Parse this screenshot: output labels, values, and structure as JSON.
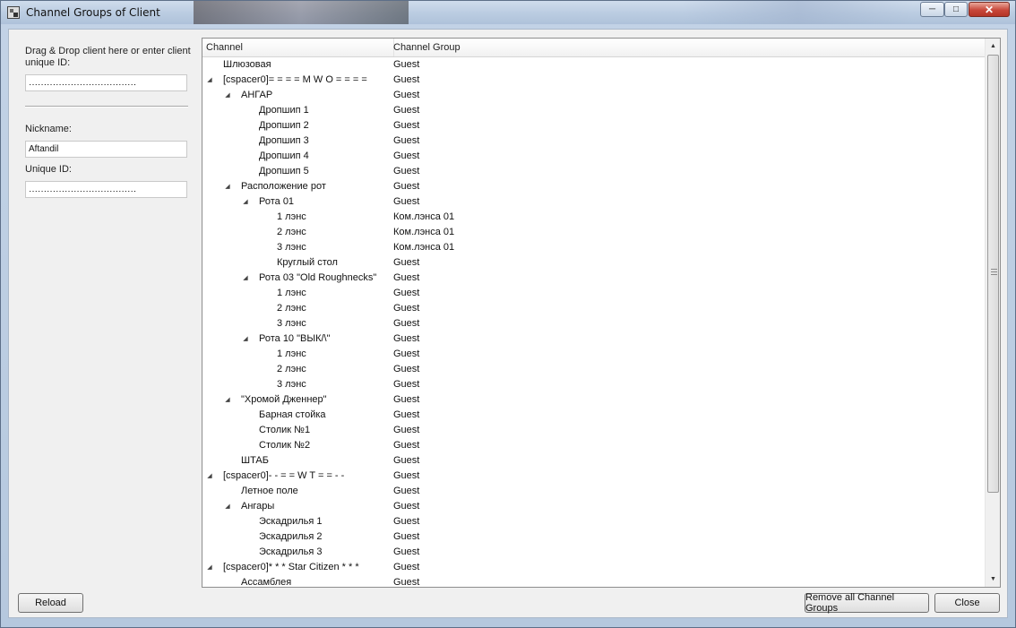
{
  "window": {
    "title": "Channel Groups of Client"
  },
  "left": {
    "drag_label": "Drag & Drop client here or enter client unique ID:",
    "client_id_value": "‥‥‥‥‥‥‥‥‥‥‥‥‥‥‥‥‥‥",
    "nickname_label": "Nickname:",
    "nickname_value": "Aftandil",
    "unique_id_label": "Unique ID:",
    "unique_id_value": "‥‥‥‥‥‥‥‥‥‥‥‥‥‥‥‥‥‥"
  },
  "tree": {
    "col_channel": "Channel",
    "col_group": "Channel Group",
    "rows": [
      {
        "name": "Шлюзовая",
        "group": "Guest",
        "depth": 1,
        "expandable": false
      },
      {
        "name": "[cspacer0]= = = = M W O = = = =",
        "group": "Guest",
        "depth": 1,
        "expandable": true
      },
      {
        "name": "АНГАР",
        "group": "Guest",
        "depth": 2,
        "expandable": true
      },
      {
        "name": "Дропшип 1",
        "group": "Guest",
        "depth": 3,
        "expandable": false
      },
      {
        "name": "Дропшип 2",
        "group": "Guest",
        "depth": 3,
        "expandable": false
      },
      {
        "name": "Дропшип 3",
        "group": "Guest",
        "depth": 3,
        "expandable": false
      },
      {
        "name": "Дропшип 4",
        "group": "Guest",
        "depth": 3,
        "expandable": false
      },
      {
        "name": "Дропшип 5",
        "group": "Guest",
        "depth": 3,
        "expandable": false
      },
      {
        "name": "Расположение рот",
        "group": "Guest",
        "depth": 2,
        "expandable": true
      },
      {
        "name": "Рота 01",
        "group": "Guest",
        "depth": 3,
        "expandable": true
      },
      {
        "name": "1 лэнс",
        "group": "Ком.лэнса 01",
        "depth": 4,
        "expandable": false
      },
      {
        "name": "2 лэнс",
        "group": "Ком.лэнса 01",
        "depth": 4,
        "expandable": false
      },
      {
        "name": "3 лэнс",
        "group": "Ком.лэнса 01",
        "depth": 4,
        "expandable": false
      },
      {
        "name": "Круглый стол",
        "group": "Guest",
        "depth": 4,
        "expandable": false
      },
      {
        "name": "Рота 03 \"Old Roughnecks\"",
        "group": "Guest",
        "depth": 3,
        "expandable": true
      },
      {
        "name": "1 лэнс",
        "group": "Guest",
        "depth": 4,
        "expandable": false
      },
      {
        "name": "2 лэнс",
        "group": "Guest",
        "depth": 4,
        "expandable": false
      },
      {
        "name": "3 лэнс",
        "group": "Guest",
        "depth": 4,
        "expandable": false
      },
      {
        "name": "Рота 10 \"ВЫК/\\\"",
        "group": "Guest",
        "depth": 3,
        "expandable": true
      },
      {
        "name": "1 лэнс",
        "group": "Guest",
        "depth": 4,
        "expandable": false
      },
      {
        "name": "2 лэнс",
        "group": "Guest",
        "depth": 4,
        "expandable": false
      },
      {
        "name": "3 лэнс",
        "group": "Guest",
        "depth": 4,
        "expandable": false
      },
      {
        "name": "\"Хромой Дженнер\"",
        "group": "Guest",
        "depth": 2,
        "expandable": true
      },
      {
        "name": "Барная стойка",
        "group": "Guest",
        "depth": 3,
        "expandable": false
      },
      {
        "name": "Столик №1",
        "group": "Guest",
        "depth": 3,
        "expandable": false
      },
      {
        "name": "Столик №2",
        "group": "Guest",
        "depth": 3,
        "expandable": false
      },
      {
        "name": "ШТАБ",
        "group": "Guest",
        "depth": 2,
        "expandable": false
      },
      {
        "name": "[cspacer0]- - = = W T = = - -",
        "group": "Guest",
        "depth": 1,
        "expandable": true
      },
      {
        "name": "Летное поле",
        "group": "Guest",
        "depth": 2,
        "expandable": false
      },
      {
        "name": "Ангары",
        "group": "Guest",
        "depth": 2,
        "expandable": true
      },
      {
        "name": "Эскадрилья 1",
        "group": "Guest",
        "depth": 3,
        "expandable": false
      },
      {
        "name": "Эскадрилья 2",
        "group": "Guest",
        "depth": 3,
        "expandable": false
      },
      {
        "name": "Эскадрилья 3",
        "group": "Guest",
        "depth": 3,
        "expandable": false
      },
      {
        "name": "[cspacer0]* * * Star Citizen * * *",
        "group": "Guest",
        "depth": 1,
        "expandable": true
      },
      {
        "name": "Ассамблея",
        "group": "Guest",
        "depth": 2,
        "expandable": false
      }
    ]
  },
  "buttons": {
    "reload": "Reload",
    "remove_all": "Remove all Channel Groups",
    "close": "Close"
  },
  "icons": {
    "expanded": "triangle-expanded-icon",
    "scroll_up": "scroll-up-arrow-icon",
    "scroll_down": "scroll-down-arrow-icon",
    "window_close": "close-icon"
  }
}
